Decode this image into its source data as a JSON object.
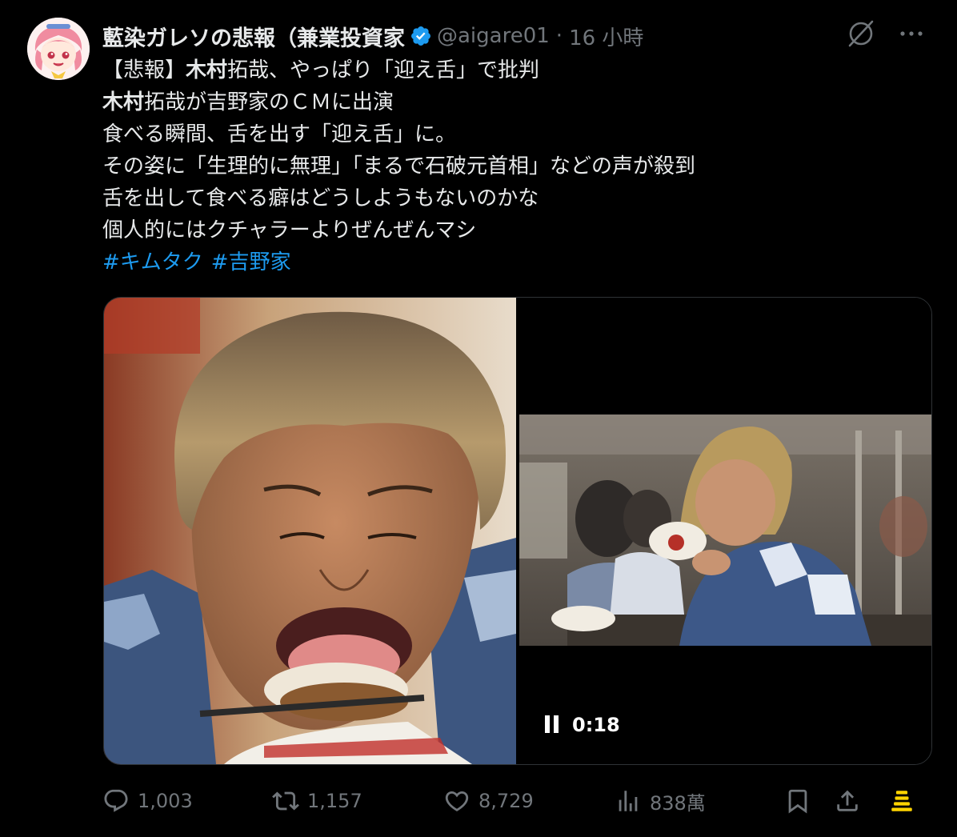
{
  "tweet": {
    "display_name": "藍染ガレソの悲報（兼業投資家",
    "handle": "@aigare01",
    "separator": "·",
    "time": "16 小時",
    "lines": [
      {
        "pre": "【悲報】",
        "bold": "木村",
        "post": "拓哉、やっぱり「迎え舌」で批判"
      },
      {
        "pre": "",
        "bold": "木村",
        "post": "拓哉が吉野家のＣＭに出演"
      },
      {
        "pre": "",
        "bold": "",
        "post": "食べる瞬間、舌を出す「迎え舌」に。"
      },
      {
        "pre": "",
        "bold": "",
        "post": "その姿に「生理的に無理」「まるで石破元首相」などの声が殺到"
      },
      {
        "pre": "",
        "bold": "",
        "post": "舌を出して食べる癖はどうしようもないのかな"
      },
      {
        "pre": "",
        "bold": "",
        "post": "個人的にはクチャラーよりぜんぜんマシ"
      }
    ],
    "hashtags": [
      "#キムタク",
      "#吉野家"
    ]
  },
  "video": {
    "time": "0:18"
  },
  "actions": {
    "replies": "1,003",
    "reposts": "1,157",
    "likes": "8,729",
    "views": "838萬"
  },
  "colors": {
    "background": "#000000",
    "text": "#e7e9ea",
    "muted": "#71767b",
    "link": "#1d9bf0",
    "verified": "#1d9bf0",
    "premium": "#ffd400"
  },
  "icons": [
    "grok-icon",
    "more-icon",
    "verified-badge-icon",
    "reply-icon",
    "repost-icon",
    "like-icon",
    "views-icon",
    "bookmark-icon",
    "share-icon",
    "premium-stack-icon",
    "pause-icon"
  ]
}
